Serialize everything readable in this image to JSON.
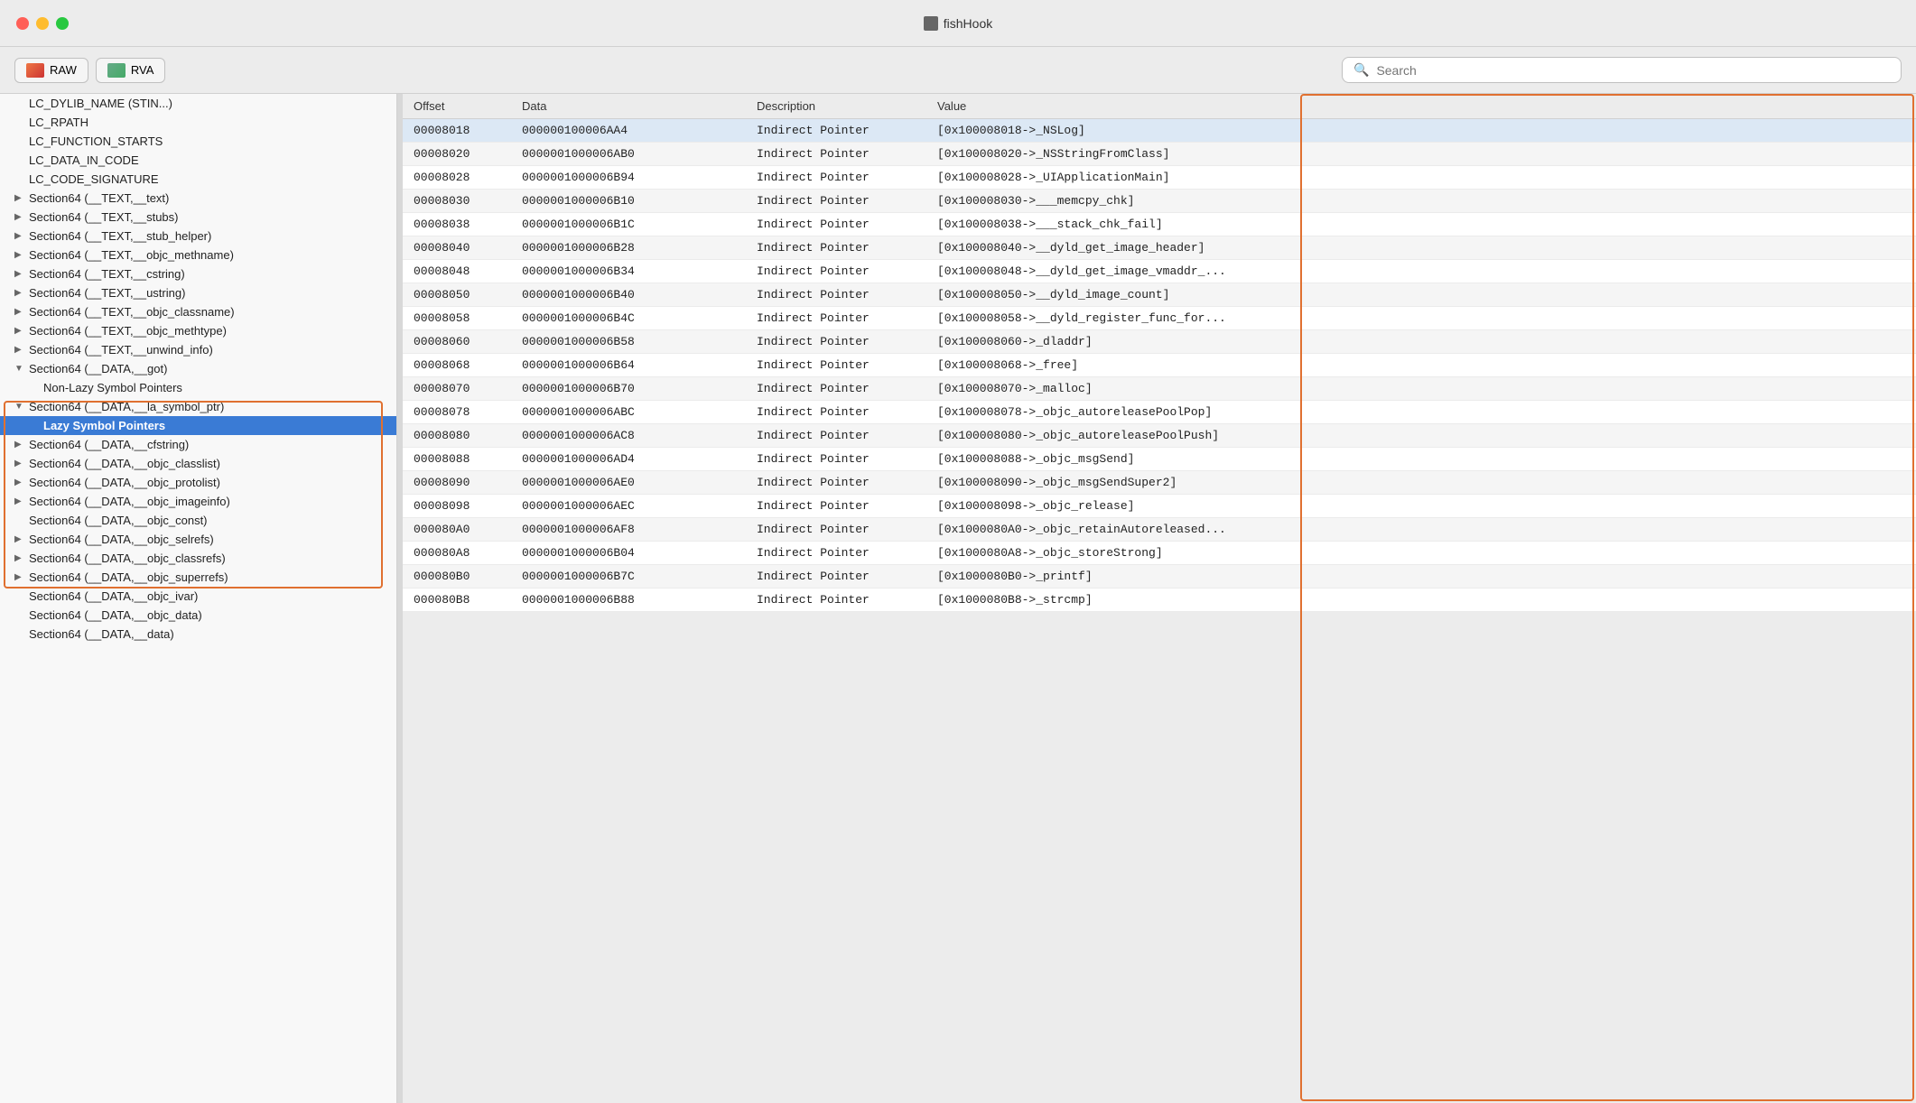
{
  "window": {
    "title": "fishHook",
    "icon": "■"
  },
  "toolbar": {
    "raw_label": "RAW",
    "rva_label": "RVA",
    "search_placeholder": "Search"
  },
  "left_panel": {
    "items": [
      {
        "id": "lc_dylib_name",
        "label": "LC_DYLIB_NAME (STIN...)",
        "level": 0,
        "arrow": ""
      },
      {
        "id": "lc_rpath",
        "label": "LC_RPATH",
        "level": 0,
        "arrow": ""
      },
      {
        "id": "lc_function_starts",
        "label": "LC_FUNCTION_STARTS",
        "level": 0,
        "arrow": ""
      },
      {
        "id": "lc_data_in_code",
        "label": "LC_DATA_IN_CODE",
        "level": 0,
        "arrow": ""
      },
      {
        "id": "lc_code_signature",
        "label": "LC_CODE_SIGNATURE",
        "level": 0,
        "arrow": ""
      },
      {
        "id": "section64_text_text",
        "label": "Section64 (__TEXT,__text)",
        "level": 0,
        "arrow": "▶"
      },
      {
        "id": "section64_text_stubs",
        "label": "Section64 (__TEXT,__stubs)",
        "level": 0,
        "arrow": "▶"
      },
      {
        "id": "section64_text_stub_helper",
        "label": "Section64 (__TEXT,__stub_helper)",
        "level": 0,
        "arrow": "▶"
      },
      {
        "id": "section64_text_objc_methname",
        "label": "Section64 (__TEXT,__objc_methname)",
        "level": 0,
        "arrow": "▶"
      },
      {
        "id": "section64_text_cstring",
        "label": "Section64 (__TEXT,__cstring)",
        "level": 0,
        "arrow": "▶"
      },
      {
        "id": "section64_text_ustring",
        "label": "Section64 (__TEXT,__ustring)",
        "level": 0,
        "arrow": "▶"
      },
      {
        "id": "section64_text_objc_classname",
        "label": "Section64 (__TEXT,__objc_classname)",
        "level": 0,
        "arrow": "▶"
      },
      {
        "id": "section64_text_objc_methtype",
        "label": "Section64 (__TEXT,__objc_methtype)",
        "level": 0,
        "arrow": "▶"
      },
      {
        "id": "section64_text_unwind_info",
        "label": "Section64 (__TEXT,__unwind_info)",
        "level": 0,
        "arrow": "▶"
      },
      {
        "id": "section64_data_got",
        "label": "Section64 (__DATA,__got)",
        "level": 0,
        "arrow": "▼",
        "highlighted": true
      },
      {
        "id": "non_lazy_symbol_pointers",
        "label": "Non-Lazy Symbol Pointers",
        "level": 1,
        "arrow": "",
        "highlighted": true
      },
      {
        "id": "section64_data_la_symbol_ptr",
        "label": "Section64 (__DATA,__la_symbol_ptr)",
        "level": 0,
        "arrow": "▼",
        "highlighted": true
      },
      {
        "id": "lazy_symbol_pointers",
        "label": "Lazy Symbol Pointers",
        "level": 1,
        "arrow": "",
        "selected": true,
        "highlighted": true
      },
      {
        "id": "section64_data_cfstring",
        "label": "Section64 (__DATA,__cfstring)",
        "level": 0,
        "arrow": "▶",
        "highlighted": true
      },
      {
        "id": "section64_data_objc_classlist",
        "label": "Section64 (__DATA,__objc_classlist)",
        "level": 0,
        "arrow": "▶"
      },
      {
        "id": "section64_data_objc_protolist",
        "label": "Section64 (__DATA,__objc_protolist)",
        "level": 0,
        "arrow": "▶"
      },
      {
        "id": "section64_data_objc_imageinfo",
        "label": "Section64 (__DATA,__objc_imageinfo)",
        "level": 0,
        "arrow": "▶"
      },
      {
        "id": "section64_data_objc_const",
        "label": "Section64 (__DATA,__objc_const)",
        "level": 0,
        "arrow": ""
      },
      {
        "id": "section64_data_objc_selrefs",
        "label": "Section64 (__DATA,__objc_selrefs)",
        "level": 0,
        "arrow": "▶"
      },
      {
        "id": "section64_data_objc_classrefs",
        "label": "Section64 (__DATA,__objc_classrefs)",
        "level": 0,
        "arrow": "▶"
      },
      {
        "id": "section64_data_objc_superrefs",
        "label": "Section64 (__DATA,__objc_superrefs)",
        "level": 0,
        "arrow": "▶"
      },
      {
        "id": "section64_data_objc_ivar",
        "label": "Section64 (__DATA,__objc_ivar)",
        "level": 0,
        "arrow": ""
      },
      {
        "id": "section64_data_objc_data",
        "label": "Section64 (__DATA,__objc_data)",
        "level": 0,
        "arrow": ""
      },
      {
        "id": "section64_data_data",
        "label": "Section64 (__DATA,__data)",
        "level": 0,
        "arrow": ""
      }
    ]
  },
  "table": {
    "headers": [
      "Offset",
      "Data",
      "Description",
      "Value"
    ],
    "rows": [
      {
        "offset": "00008018",
        "data": "000000100006AA4",
        "desc": "Indirect Pointer",
        "value": "[0x100008018->_NSLog]"
      },
      {
        "offset": "00008020",
        "data": "0000001000006AB0",
        "desc": "Indirect Pointer",
        "value": "[0x100008020->_NSStringFromClass]"
      },
      {
        "offset": "00008028",
        "data": "0000001000006B94",
        "desc": "Indirect Pointer",
        "value": "[0x100008028->_UIApplicationMain]"
      },
      {
        "offset": "00008030",
        "data": "0000001000006B10",
        "desc": "Indirect Pointer",
        "value": "[0x100008030->___memcpy_chk]"
      },
      {
        "offset": "00008038",
        "data": "0000001000006B1C",
        "desc": "Indirect Pointer",
        "value": "[0x100008038->___stack_chk_fail]"
      },
      {
        "offset": "00008040",
        "data": "0000001000006B28",
        "desc": "Indirect Pointer",
        "value": "[0x100008040->__dyld_get_image_header]"
      },
      {
        "offset": "00008048",
        "data": "0000001000006B34",
        "desc": "Indirect Pointer",
        "value": "[0x100008048->__dyld_get_image_vmaddr_..."
      },
      {
        "offset": "00008050",
        "data": "0000001000006B40",
        "desc": "Indirect Pointer",
        "value": "[0x100008050->__dyld_image_count]"
      },
      {
        "offset": "00008058",
        "data": "0000001000006B4C",
        "desc": "Indirect Pointer",
        "value": "[0x100008058->__dyld_register_func_for..."
      },
      {
        "offset": "00008060",
        "data": "0000001000006B58",
        "desc": "Indirect Pointer",
        "value": "[0x100008060->_dladdr]"
      },
      {
        "offset": "00008068",
        "data": "0000001000006B64",
        "desc": "Indirect Pointer",
        "value": "[0x100008068->_free]"
      },
      {
        "offset": "00008070",
        "data": "0000001000006B70",
        "desc": "Indirect Pointer",
        "value": "[0x100008070->_malloc]"
      },
      {
        "offset": "00008078",
        "data": "0000001000006ABC",
        "desc": "Indirect Pointer",
        "value": "[0x100008078->_objc_autoreleasePoolPop]"
      },
      {
        "offset": "00008080",
        "data": "0000001000006AC8",
        "desc": "Indirect Pointer",
        "value": "[0x100008080->_objc_autoreleasePoolPush]"
      },
      {
        "offset": "00008088",
        "data": "0000001000006AD4",
        "desc": "Indirect Pointer",
        "value": "[0x100008088->_objc_msgSend]"
      },
      {
        "offset": "00008090",
        "data": "0000001000006AE0",
        "desc": "Indirect Pointer",
        "value": "[0x100008090->_objc_msgSendSuper2]"
      },
      {
        "offset": "00008098",
        "data": "0000001000006AEC",
        "desc": "Indirect Pointer",
        "value": "[0x100008098->_objc_release]"
      },
      {
        "offset": "000080A0",
        "data": "0000001000006AF8",
        "desc": "Indirect Pointer",
        "value": "[0x1000080A0->_objc_retainAutoreleased..."
      },
      {
        "offset": "000080A8",
        "data": "0000001000006B04",
        "desc": "Indirect Pointer",
        "value": "[0x1000080A8->_objc_storeStrong]"
      },
      {
        "offset": "000080B0",
        "data": "0000001000006B7C",
        "desc": "Indirect Pointer",
        "value": "[0x1000080B0->_printf]"
      },
      {
        "offset": "000080B8",
        "data": "0000001000006B88",
        "desc": "Indirect Pointer",
        "value": "[0x1000080B8->_strcmp]"
      }
    ]
  }
}
